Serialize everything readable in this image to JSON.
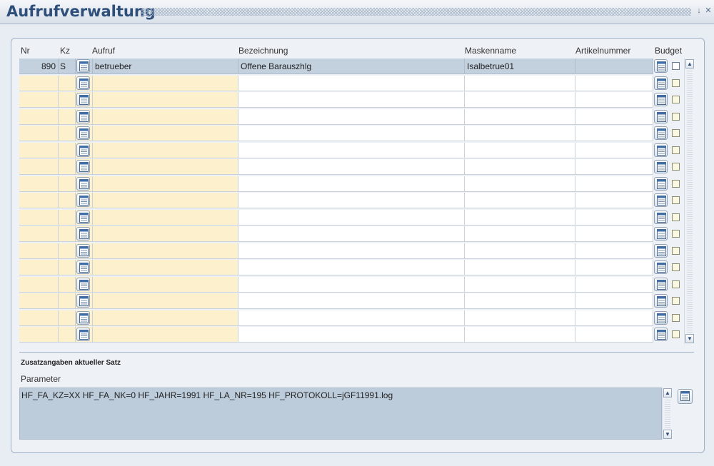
{
  "window": {
    "title": "Aufrufverwaltung",
    "minimize_icon": "minimize-icon",
    "close_icon": "close-icon"
  },
  "grid": {
    "columns": {
      "nr": "Nr",
      "kz": "Kz",
      "aufruf": "Aufruf",
      "bezeichnung": "Bezeichnung",
      "maskenname": "Maskenname",
      "artikelnummer": "Artikelnummer",
      "budget": "Budget"
    },
    "rows": [
      {
        "nr": "890",
        "kz": "S",
        "aufruf": "betrueber",
        "bezeichnung": "Offene Barauszhlg",
        "maskenname": "Isalbetrue01",
        "artikelnummer": "",
        "budget": false
      },
      {
        "nr": "",
        "kz": "",
        "aufruf": "",
        "bezeichnung": "",
        "maskenname": "",
        "artikelnummer": "",
        "budget": false
      },
      {
        "nr": "",
        "kz": "",
        "aufruf": "",
        "bezeichnung": "",
        "maskenname": "",
        "artikelnummer": "",
        "budget": false
      },
      {
        "nr": "",
        "kz": "",
        "aufruf": "",
        "bezeichnung": "",
        "maskenname": "",
        "artikelnummer": "",
        "budget": false
      },
      {
        "nr": "",
        "kz": "",
        "aufruf": "",
        "bezeichnung": "",
        "maskenname": "",
        "artikelnummer": "",
        "budget": false
      },
      {
        "nr": "",
        "kz": "",
        "aufruf": "",
        "bezeichnung": "",
        "maskenname": "",
        "artikelnummer": "",
        "budget": false
      },
      {
        "nr": "",
        "kz": "",
        "aufruf": "",
        "bezeichnung": "",
        "maskenname": "",
        "artikelnummer": "",
        "budget": false
      },
      {
        "nr": "",
        "kz": "",
        "aufruf": "",
        "bezeichnung": "",
        "maskenname": "",
        "artikelnummer": "",
        "budget": false
      },
      {
        "nr": "",
        "kz": "",
        "aufruf": "",
        "bezeichnung": "",
        "maskenname": "",
        "artikelnummer": "",
        "budget": false
      },
      {
        "nr": "",
        "kz": "",
        "aufruf": "",
        "bezeichnung": "",
        "maskenname": "",
        "artikelnummer": "",
        "budget": false
      },
      {
        "nr": "",
        "kz": "",
        "aufruf": "",
        "bezeichnung": "",
        "maskenname": "",
        "artikelnummer": "",
        "budget": false
      },
      {
        "nr": "",
        "kz": "",
        "aufruf": "",
        "bezeichnung": "",
        "maskenname": "",
        "artikelnummer": "",
        "budget": false
      },
      {
        "nr": "",
        "kz": "",
        "aufruf": "",
        "bezeichnung": "",
        "maskenname": "",
        "artikelnummer": "",
        "budget": false
      },
      {
        "nr": "",
        "kz": "",
        "aufruf": "",
        "bezeichnung": "",
        "maskenname": "",
        "artikelnummer": "",
        "budget": false
      },
      {
        "nr": "",
        "kz": "",
        "aufruf": "",
        "bezeichnung": "",
        "maskenname": "",
        "artikelnummer": "",
        "budget": false
      },
      {
        "nr": "",
        "kz": "",
        "aufruf": "",
        "bezeichnung": "",
        "maskenname": "",
        "artikelnummer": "",
        "budget": false
      },
      {
        "nr": "",
        "kz": "",
        "aufruf": "",
        "bezeichnung": "",
        "maskenname": "",
        "artikelnummer": "",
        "budget": false
      }
    ],
    "selected_row": 0
  },
  "details": {
    "section_title": "Zusatzangaben aktueller Satz",
    "parameter_label": "Parameter",
    "parameter_value": "HF_FA_KZ=XX HF_FA_NK=0 HF_JAHR=1991 HF_LA_NR=195 HF_PROTOKOLL=jGF11991.log"
  },
  "icons": {
    "lov_button": "list-of-values-icon",
    "scroll_up": "scroll-up-arrow-icon",
    "scroll_down": "scroll-down-arrow-icon"
  },
  "colors": {
    "title_text": "#2e4f7a",
    "key_field_bg": "#fcf0cd",
    "selected_row_bg": "#c3d1df",
    "parameter_bg": "#bdccdb"
  }
}
